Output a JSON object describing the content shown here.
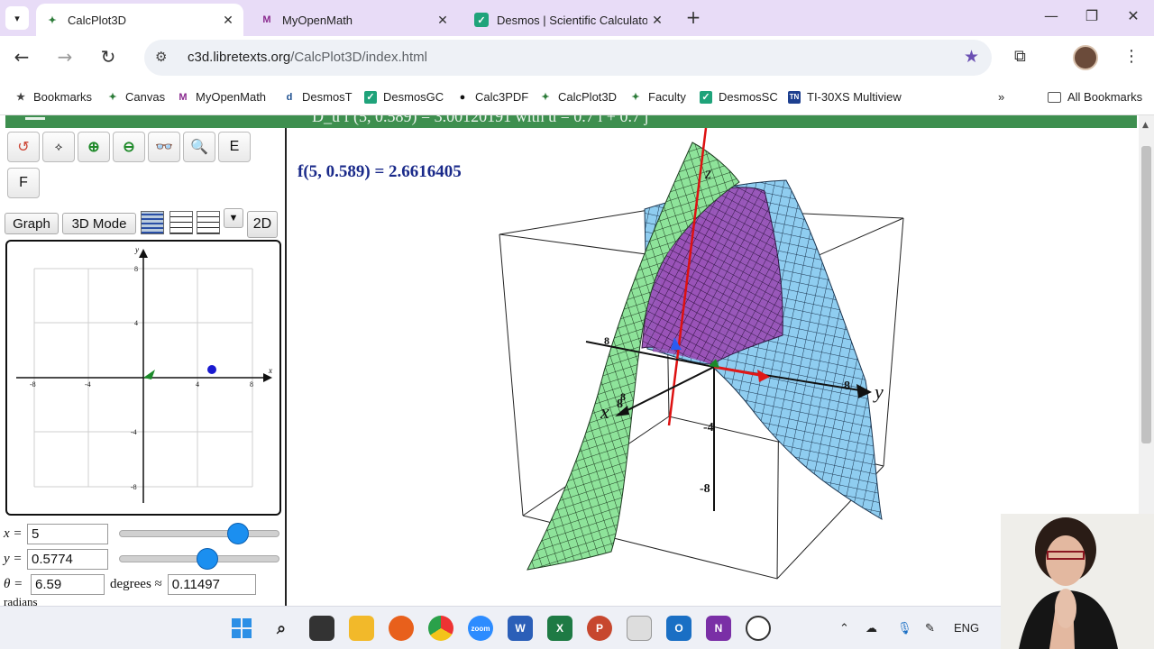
{
  "browser": {
    "tabs": [
      {
        "title": "CalcPlot3D",
        "active": true
      },
      {
        "title": "MyOpenMath",
        "active": false
      },
      {
        "title": "Desmos | Scientific Calculator",
        "active": false
      }
    ],
    "url_domain": "c3d.libretexts.org",
    "url_path": "/CalcPlot3D/index.html",
    "bookmarks": [
      "Bookmarks",
      "Canvas",
      "MyOpenMath",
      "DesmosT",
      "DesmosGC",
      "Calc3PDF",
      "CalcPlot3D",
      "Faculty",
      "DesmosSC",
      "TI-30XS Multiview"
    ],
    "all_bookmarks": "All Bookmarks",
    "overflow": "»"
  },
  "app": {
    "header_text": "D_u f (5, 0.589) = 3.00120191 with u = 0.7 i + 0.7 j",
    "letter_buttons": [
      "E",
      "F"
    ],
    "mode_buttons": {
      "graph": "Graph",
      "mode3d": "3D Mode",
      "mode2d": "2D"
    },
    "graph2d": {
      "x_axis_label": "x",
      "y_axis_label": "y",
      "x_ticks": [
        "-8",
        "-4",
        "4",
        "8"
      ],
      "y_ticks": [
        "8",
        "4",
        "-4",
        "-8"
      ]
    },
    "controls": {
      "x_label": "x =",
      "x_value": "5",
      "x_slider": 0.77,
      "y_label": "y =",
      "y_value": "0.5774",
      "y_slider": 0.55,
      "theta_label": "θ =",
      "theta_value": "6.59",
      "degrees_text": "degrees ≈",
      "radians_value": "0.11497",
      "radians_text": "radians"
    },
    "main": {
      "function_value": "f(5, 0.589) = 2.6616405",
      "axis_labels": {
        "x": "x",
        "y": "y",
        "z": "z"
      },
      "tick_labels": [
        "8",
        "8",
        "-4",
        "-8",
        "8",
        "8"
      ]
    }
  },
  "taskbar": {
    "tray_lang": "ENG",
    "apps": [
      "zoom",
      "W",
      "X",
      "P",
      "O",
      "N"
    ]
  }
}
